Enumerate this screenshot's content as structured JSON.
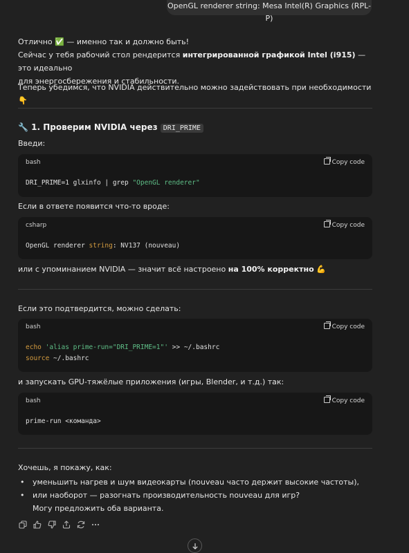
{
  "user_message": "OpenGL renderer string: Mesa Intel(R) Graphics (RPL-P)",
  "intro": {
    "line1": "Отлично ✅ — именно так и должно быть!",
    "line2_pre": "Сейчас у тебя рабочий стол рендерится ",
    "line2_bold": "интегрированной графикой Intel (i915)",
    "line2_post": " — это идеально",
    "line3": "для энергосбережения и стабильности.",
    "line4": "Теперь убедимся, что NVIDIA действительно можно задействовать при необходимости 👇"
  },
  "section1": {
    "heading_emoji": "🔧",
    "heading_text": "1. Проверим NVIDIA через",
    "heading_code": "DRI_PRIME",
    "enter_label": "Введи:",
    "result_label": "Если в ответе появится что-то вроде:",
    "nvidia_pre": "или с упоминанием NVIDIA — значит всё настроено ",
    "nvidia_bold": "на 100% корректно",
    "nvidia_emoji": "💪"
  },
  "section2": {
    "confirm_label": "Если это подтвердится, можно сделать:",
    "run_label": "и запускать GPU-тяжёлые приложения (игры, Blender, и т.д.) так:"
  },
  "closing": {
    "offer": "Хочешь, я покажу, как:",
    "items": [
      "уменьшить нагрев и шум видеокарты (nouveau часто держит высокие частоты),",
      "или наоборот — разогнать производительность nouveau для игр?"
    ],
    "suggestion": "Могу предложить оба варианта."
  },
  "code_blocks": [
    {
      "lang": "bash",
      "copy": "Copy code",
      "cmd": "DRI_PRIME=1 glxinfo | grep ",
      "str": "\"OpenGL renderer\""
    },
    {
      "lang": "csharp",
      "copy": "Copy code",
      "a": "OpenGL renderer ",
      "kw": "string",
      "b": ": NV137 (nouveau)"
    },
    {
      "lang": "bash",
      "copy": "Copy code",
      "echo": "echo",
      "alias_str": "'alias prime-run=\"DRI_PRIME=1\"'",
      "redir": " >> ~/.bashrc",
      "source": "source",
      "src_arg": " ~/.bashrc"
    },
    {
      "lang": "bash",
      "copy": "Copy code",
      "cmd": "prime-run <команда>"
    }
  ],
  "icons": [
    "copy-icon",
    "thumbs-up-icon",
    "thumbs-down-icon",
    "share-icon",
    "regenerate-icon",
    "more-icon",
    "arrow-down-icon"
  ]
}
